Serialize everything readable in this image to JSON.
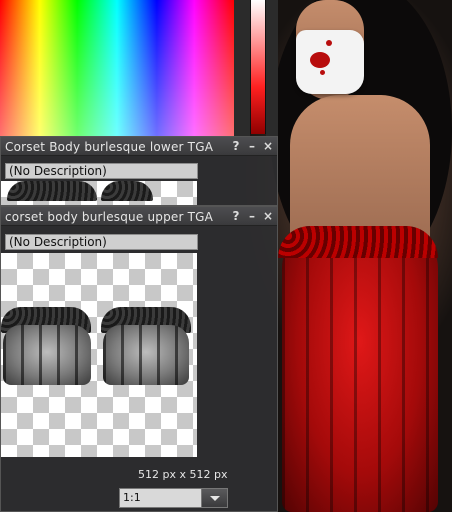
{
  "color_picker": {
    "spectrum": "hue-saturation-spectrum",
    "slider": "luminance-slider",
    "selected_color": "#ff2020"
  },
  "window_lower": {
    "title": "Corset Body burlesque lower TGA",
    "help_label": "?",
    "minimize_label": "–",
    "close_label": "×",
    "description": "(No Description)"
  },
  "window_upper": {
    "title": "corset body burlesque upper TGA",
    "help_label": "?",
    "minimize_label": "–",
    "close_label": "×",
    "description": "(No Description)",
    "resolution": "512 px x 512 px",
    "zoom": {
      "selected": "1:1",
      "dropdown_icon": "chevron-down-icon"
    }
  },
  "scene": {
    "accent_red": "#c41212",
    "mask_color": "#f3f3f3"
  }
}
